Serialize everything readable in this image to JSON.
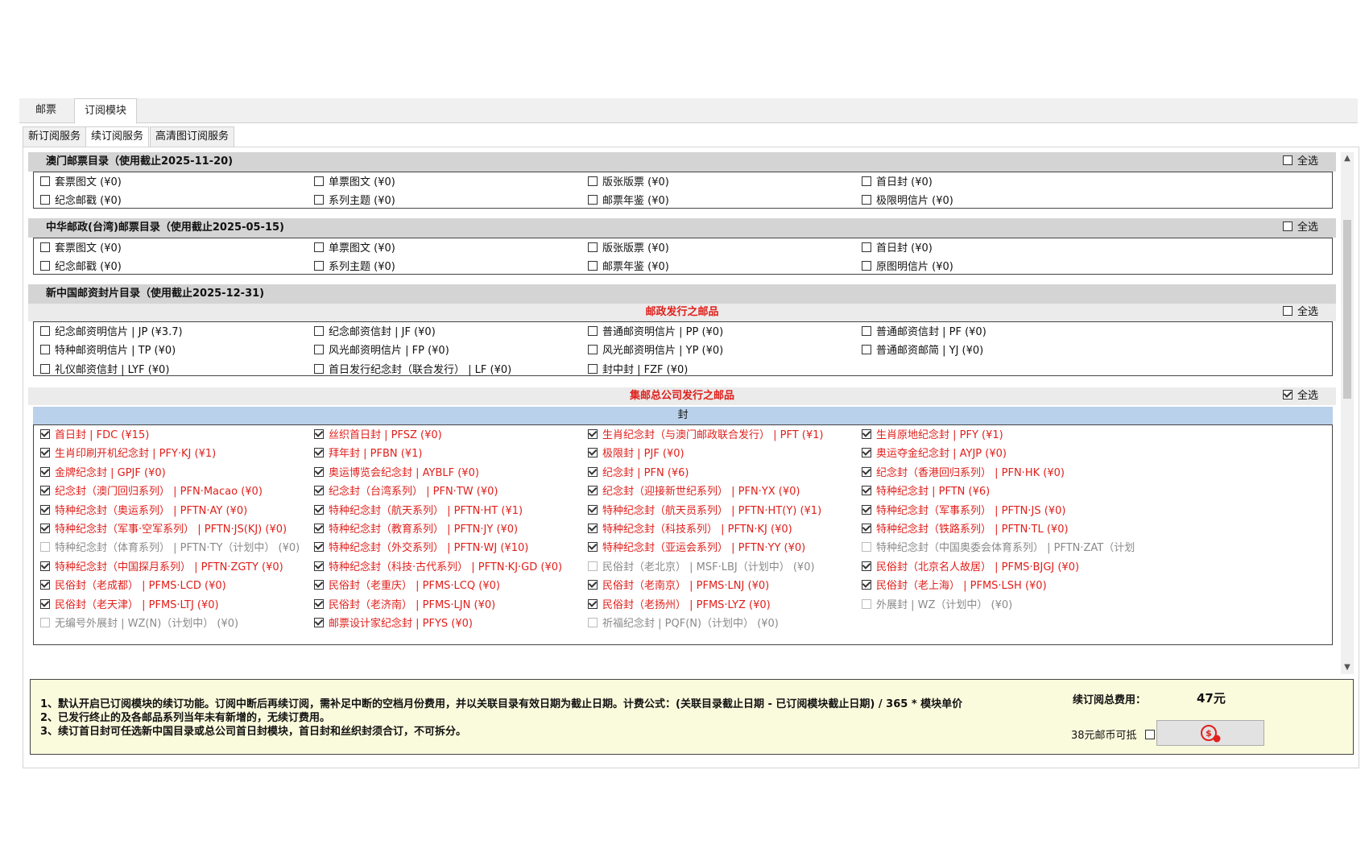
{
  "tabs_top": [
    "邮票",
    "订阅模块"
  ],
  "tabs_sub": [
    "新订阅服务",
    "续订阅服务",
    "高清图订阅服务"
  ],
  "select_all": "全选",
  "sections": {
    "macau": {
      "title": "澳门邮票目录（使用截止2025-11-20)",
      "items": [
        "套票图文 (¥0)",
        "单票图文 (¥0)",
        "版张版票 (¥0)",
        "首日封 (¥0)",
        "纪念邮戳 (¥0)",
        "系列主题 (¥0)",
        "邮票年鉴 (¥0)",
        "极限明信片 (¥0)"
      ]
    },
    "taiwan": {
      "title": "中华邮政(台湾)邮票目录（使用截止2025-05-15)",
      "items": [
        "套票图文 (¥0)",
        "单票图文 (¥0)",
        "版张版票 (¥0)",
        "首日封 (¥0)",
        "纪念邮戳 (¥0)",
        "系列主题 (¥0)",
        "邮票年鉴 (¥0)",
        "原图明信片 (¥0)"
      ]
    },
    "china": {
      "title": "新中国邮资封片目录（使用截止2025-12-31)",
      "postal_head": "邮政发行之邮品",
      "postal_items": [
        "纪念邮资明信片 | JP (¥3.7)",
        "纪念邮资信封 | JF (¥0)",
        "普通邮资明信片 | PP (¥0)",
        "普通邮资信封 | PF (¥0)",
        "特种邮资明信片 | TP (¥0)",
        "风光邮资明信片 | FP (¥0)",
        "风光邮资明信片 | YP (¥0)",
        "普通邮资邮简 | YJ (¥0)",
        "礼仪邮资信封 | LYF (¥0)",
        "首日发行纪念封（联合发行） | LF (¥0)",
        "封中封 | FZF (¥0)"
      ],
      "company_head": "集邮总公司发行之邮品",
      "cover_head": "封",
      "company_items": [
        "首日封 | FDC (¥15)",
        "丝织首日封 | PFSZ (¥0)",
        "生肖纪念封（与澳门邮政联合发行） | PFT (¥1)",
        "生肖原地纪念封 | PFY (¥1)",
        "生肖印刷开机纪念封 | PFY·KJ (¥1)",
        "拜年封 | PFBN (¥1)",
        "极限封 | PJF (¥0)",
        "奥运夺金纪念封 | AYJP (¥0)",
        "金牌纪念封 | GPJF (¥0)",
        "奥运博览会纪念封 | AYBLF (¥0)",
        "纪念封 | PFN (¥6)",
        "纪念封（香港回归系列） | PFN·HK (¥0)",
        "纪念封（澳门回归系列） | PFN·Macao (¥0)",
        "纪念封（台湾系列） | PFN·TW (¥0)",
        "纪念封（迎接新世纪系列） | PFN·YX (¥0)",
        "特种纪念封 | PFTN (¥6)",
        "特种纪念封（奥运系列） | PFTN·AY (¥0)",
        "特种纪念封（航天系列） | PFTN·HT (¥1)",
        "特种纪念封（航天员系列） | PFTN·HT(Y) (¥1)",
        "特种纪念封（军事系列） | PFTN·JS (¥0)",
        "特种纪念封（军事·空军系列） | PFTN·JS(KJ) (¥0)",
        "特种纪念封（教育系列） | PFTN·JY (¥0)",
        "特种纪念封（科技系列） | PFTN·KJ (¥0)",
        "特种纪念封（铁路系列） | PFTN·TL (¥0)",
        "特种纪念封（体育系列） | PFTN·TY（计划中） (¥0)",
        "特种纪念封（外交系列） | PFTN·WJ (¥10)",
        "特种纪念封（亚运会系列） | PFTN·YY (¥0)",
        "特种纪念封（中国奥委会体育系列） | PFTN·ZAT（计划",
        "特种纪念封（中国探月系列） | PFTN·ZGTY (¥0)",
        "特种纪念封（科技·古代系列） | PFTN·KJ·GD (¥0)",
        "民俗封（老北京） | MSF·LBJ（计划中） (¥0)",
        "民俗封（北京名人故居） | PFMS·BJGJ (¥0)",
        "民俗封（老成都） | PFMS·LCD (¥0)",
        "民俗封（老重庆） | PFMS·LCQ (¥0)",
        "民俗封（老南京） | PFMS·LNJ (¥0)",
        "民俗封（老上海） | PFMS·LSH (¥0)",
        "民俗封（老天津） | PFMS·LTJ (¥0)",
        "民俗封（老济南） | PFMS·LJN (¥0)",
        "民俗封（老扬州） | PFMS·LYZ (¥0)",
        "外展封 | WZ（计划中） (¥0)",
        "无编号外展封 | WZ(N)（计划中） (¥0)",
        "邮票设计家纪念封 | PFYS (¥0)",
        "祈福纪念封 | PQF(N)（计划中） (¥0)"
      ],
      "company_disabled": [
        24,
        27,
        30,
        39,
        40,
        42
      ]
    }
  },
  "footer": {
    "notes": [
      "1、默认开启已订阅模块的续订功能。订阅中断后再续订阅，需补足中断的空档月份费用，并以关联目录有效日期为截止日期。计费公式：(关联目录截止日期 - 已订阅模块截止日期) / 365 * 模块单价",
      "2、已发行终止的及各邮品系列当年未有新增的，无续订费用。",
      "3、续订首日封可任选新中国目录或总公司首日封模块，首日封和丝织封须合订，不可拆分。"
    ],
    "total_label": "续订阅总费用：",
    "total_value": "47元",
    "coin_label": "38元邮币可抵"
  },
  "colors": {
    "accent_red": "#e0201c",
    "cover_head_bg": "#b9d1ea",
    "footer_bg": "#fafadd"
  }
}
